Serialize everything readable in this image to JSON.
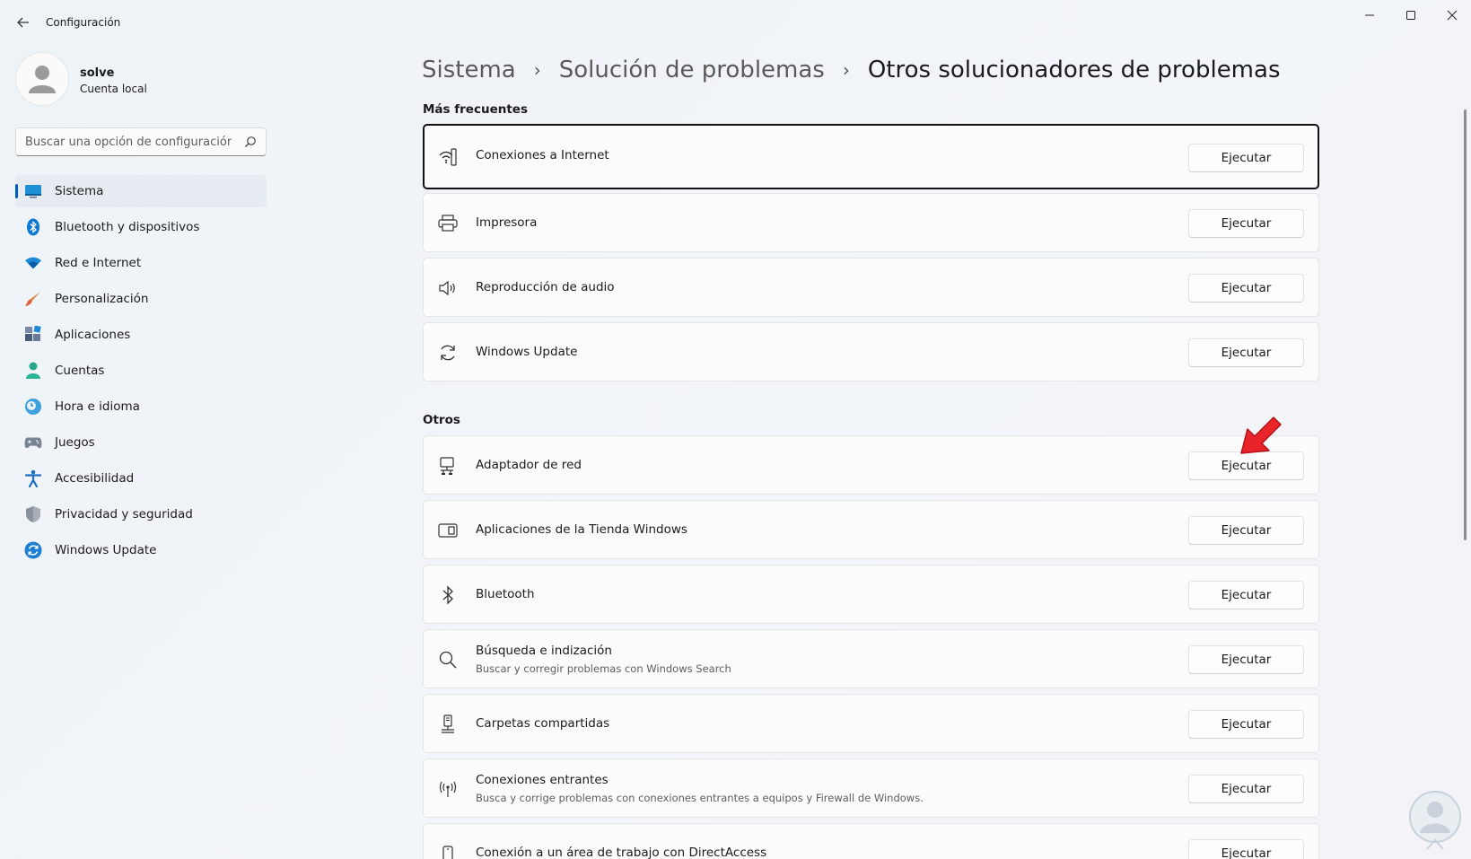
{
  "window": {
    "title": "Configuración"
  },
  "user": {
    "name": "solve",
    "account_type": "Cuenta local"
  },
  "search": {
    "placeholder": "Buscar una opción de configuración"
  },
  "sidebar": {
    "items": [
      {
        "label": "Sistema",
        "icon": "system-icon",
        "active": true
      },
      {
        "label": "Bluetooth y dispositivos",
        "icon": "bluetooth-icon",
        "active": false
      },
      {
        "label": "Red e Internet",
        "icon": "wifi-icon",
        "active": false
      },
      {
        "label": "Personalización",
        "icon": "brush-icon",
        "active": false
      },
      {
        "label": "Aplicaciones",
        "icon": "apps-icon",
        "active": false
      },
      {
        "label": "Cuentas",
        "icon": "account-icon",
        "active": false
      },
      {
        "label": "Hora e idioma",
        "icon": "clock-globe-icon",
        "active": false
      },
      {
        "label": "Juegos",
        "icon": "gamepad-icon",
        "active": false
      },
      {
        "label": "Accesibilidad",
        "icon": "accessibility-icon",
        "active": false
      },
      {
        "label": "Privacidad y seguridad",
        "icon": "shield-icon",
        "active": false
      },
      {
        "label": "Windows Update",
        "icon": "update-icon",
        "active": false
      }
    ]
  },
  "breadcrumb": [
    "Sistema",
    "Solución de problemas",
    "Otros solucionadores de problemas"
  ],
  "sections": {
    "frequent": {
      "title": "Más frecuentes",
      "items": [
        {
          "title": "Conexiones a Internet",
          "subtitle": "",
          "button": "Ejecutar",
          "icon": "internet-connection-icon"
        },
        {
          "title": "Impresora",
          "subtitle": "",
          "button": "Ejecutar",
          "icon": "printer-icon"
        },
        {
          "title": "Reproducción de audio",
          "subtitle": "",
          "button": "Ejecutar",
          "icon": "speaker-icon"
        },
        {
          "title": "Windows Update",
          "subtitle": "",
          "button": "Ejecutar",
          "icon": "sync-icon"
        }
      ]
    },
    "others": {
      "title": "Otros",
      "items": [
        {
          "title": "Adaptador de red",
          "subtitle": "",
          "button": "Ejecutar",
          "icon": "network-adapter-icon"
        },
        {
          "title": "Aplicaciones de la Tienda Windows",
          "subtitle": "",
          "button": "Ejecutar",
          "icon": "store-apps-icon"
        },
        {
          "title": "Bluetooth",
          "subtitle": "",
          "button": "Ejecutar",
          "icon": "bluetooth-icon"
        },
        {
          "title": "Búsqueda e indización",
          "subtitle": "Buscar y corregir problemas con Windows Search",
          "button": "Ejecutar",
          "icon": "search-icon"
        },
        {
          "title": "Carpetas compartidas",
          "subtitle": "",
          "button": "Ejecutar",
          "icon": "shared-folder-icon"
        },
        {
          "title": "Conexiones entrantes",
          "subtitle": "Busca y corrige problemas con conexiones entrantes a equipos y Firewall de Windows.",
          "button": "Ejecutar",
          "icon": "antenna-icon"
        },
        {
          "title": "Conexión a un área de trabajo con DirectAccess",
          "subtitle": "",
          "button": "Ejecutar",
          "icon": "phone-icon"
        }
      ]
    }
  },
  "colors": {
    "accent": "#005fb8",
    "annotation_arrow": "#e8242a"
  }
}
